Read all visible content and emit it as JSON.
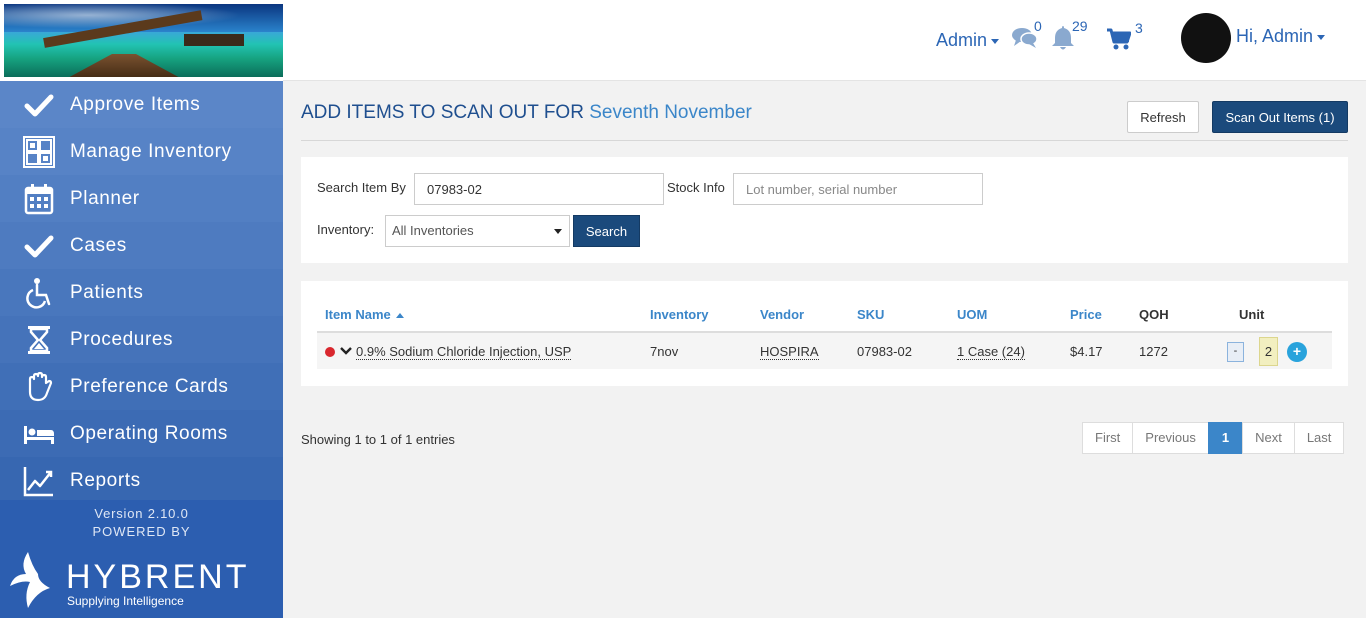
{
  "header": {
    "admin_menu_label": "Admin",
    "messages_count": "0",
    "notifications_count": "29",
    "cart_count": "3",
    "user_greeting": "Hi, Admin"
  },
  "sidebar": {
    "items": [
      {
        "label": "Approve Items",
        "icon": "check-icon"
      },
      {
        "label": "Manage Inventory",
        "icon": "inventory-grid-icon"
      },
      {
        "label": "Planner",
        "icon": "calendar-icon"
      },
      {
        "label": "Cases",
        "icon": "check-icon"
      },
      {
        "label": "Patients",
        "icon": "wheelchair-icon"
      },
      {
        "label": "Procedures",
        "icon": "hourglass-icon"
      },
      {
        "label": "Preference Cards",
        "icon": "glove-hand-icon"
      },
      {
        "label": "Operating Rooms",
        "icon": "bed-icon"
      },
      {
        "label": "Reports",
        "icon": "line-chart-icon"
      }
    ],
    "version": "Version 2.10.0",
    "powered_by": "POWERED BY",
    "brand_name": "HYBRENT",
    "brand_tagline": "Supplying Intelligence"
  },
  "page": {
    "title_prefix": "ADD ITEMS TO SCAN OUT FOR",
    "title_accent": "Seventh November",
    "refresh_label": "Refresh",
    "scan_out_label": "Scan Out Items (1)"
  },
  "search": {
    "search_by_label": "Search Item By",
    "search_value": "07983-02",
    "stock_info_label": "Stock Info",
    "stock_info_placeholder": "Lot number, serial number",
    "inventory_label": "Inventory:",
    "inventory_selected": "All Inventories",
    "search_button": "Search"
  },
  "table": {
    "headers": {
      "item_name": "Item Name",
      "inventory": "Inventory",
      "vendor": "Vendor",
      "sku": "SKU",
      "uom": "UOM",
      "price": "Price",
      "qoh": "QOH",
      "unit": "Unit"
    },
    "rows": [
      {
        "item_name": "0.9% Sodium Chloride Injection, USP",
        "inventory": "7nov",
        "vendor": "HOSPIRA",
        "sku": "07983-02",
        "uom": "1 Case (24)",
        "price": "$4.17",
        "qoh": "1272",
        "minus_label": "-",
        "unit_qty": "2",
        "plus_label": "+"
      }
    ]
  },
  "footer": {
    "entries_info": "Showing 1 to 1 of 1 entries",
    "pagination": {
      "first": "First",
      "previous": "Previous",
      "current": "1",
      "next": "Next",
      "last": "Last"
    }
  },
  "colors": {
    "sidebar_bg": "#2f5fb0",
    "primary_button": "#1b4a7c",
    "link_blue": "#3b86c9",
    "status_red": "#d9272e"
  }
}
